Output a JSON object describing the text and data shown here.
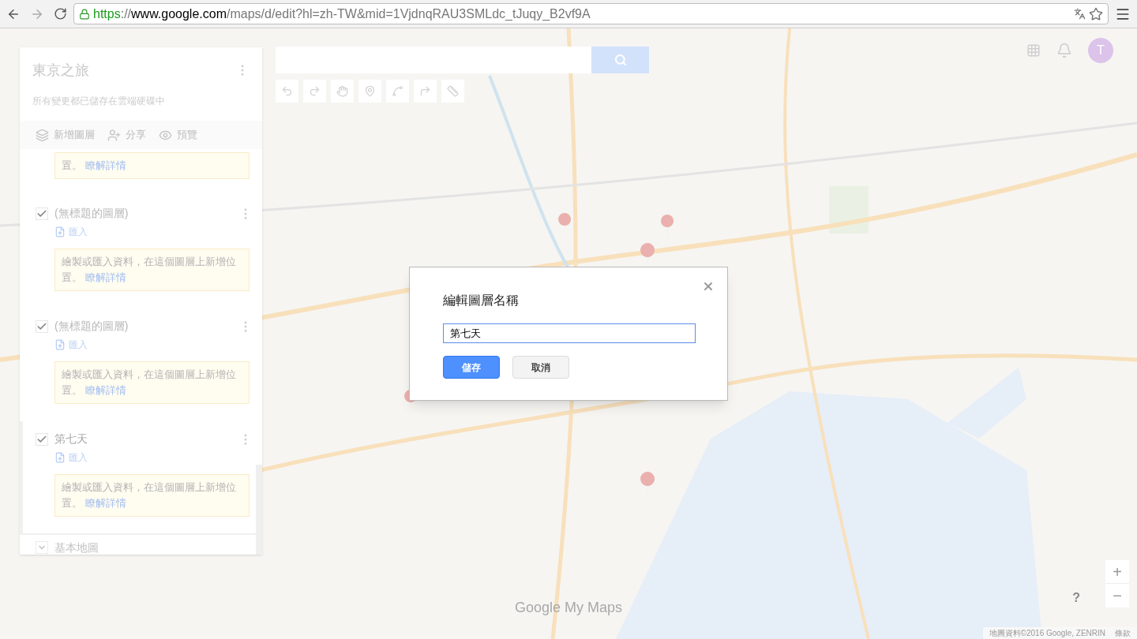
{
  "browser": {
    "url_scheme": "https",
    "url_sep": "://",
    "url_host": "www.google.com",
    "url_path": "/maps/d/edit?hl=zh-TW&mid=1VjdnqRAU3SMLdc_tJuqy_B2vf9A"
  },
  "panel": {
    "title": "東京之旅",
    "status": "所有變更都已儲存在雲端硬碟中",
    "actions": [
      {
        "kind": "layers",
        "label": "新增圖層"
      },
      {
        "kind": "share",
        "label": "分享"
      },
      {
        "kind": "preview",
        "label": "預覽"
      }
    ],
    "layers": [
      {
        "kind": "partial",
        "selected": false,
        "tip": "置。",
        "tip_link": "瞭解詳情"
      },
      {
        "kind": "full",
        "name": "(無標題的圖層)",
        "checked": true,
        "selected": false,
        "import_label": "匯入",
        "tip": "繪製或匯入資料，在這個圖層上新增位置。",
        "tip_link": "瞭解詳情"
      },
      {
        "kind": "full",
        "name": "(無標題的圖層)",
        "checked": true,
        "selected": false,
        "import_label": "匯入",
        "tip": "繪製或匯入資料，在這個圖層上新增位置。",
        "tip_link": "瞭解詳情"
      },
      {
        "kind": "full",
        "name": "第七天",
        "checked": true,
        "selected": true,
        "import_label": "匯入",
        "tip": "繪製或匯入資料，在這個圖層上新增位置。",
        "tip_link": "瞭解詳情"
      }
    ],
    "base_map": {
      "label": "基本地圖",
      "expanded": false
    }
  },
  "tools": [
    {
      "kind": "undo"
    },
    {
      "kind": "redo"
    },
    {
      "kind": "hand"
    },
    {
      "kind": "marker"
    },
    {
      "kind": "line"
    },
    {
      "kind": "directions"
    },
    {
      "kind": "ruler"
    }
  ],
  "account": {
    "initial": "T"
  },
  "logo": {
    "brand": "Google",
    "product": "My Maps"
  },
  "zoom": {
    "in": "+",
    "out": "−",
    "help": "?"
  },
  "attribution": {
    "text": "地圖資料©2016 Google, ZENRIN",
    "terms": "條款"
  },
  "dialog": {
    "title": "編輯圖層名稱",
    "value": "第七天",
    "buttons": [
      {
        "kind": "primary",
        "label": "儲存"
      },
      {
        "kind": "secondary",
        "label": "取消"
      }
    ]
  }
}
